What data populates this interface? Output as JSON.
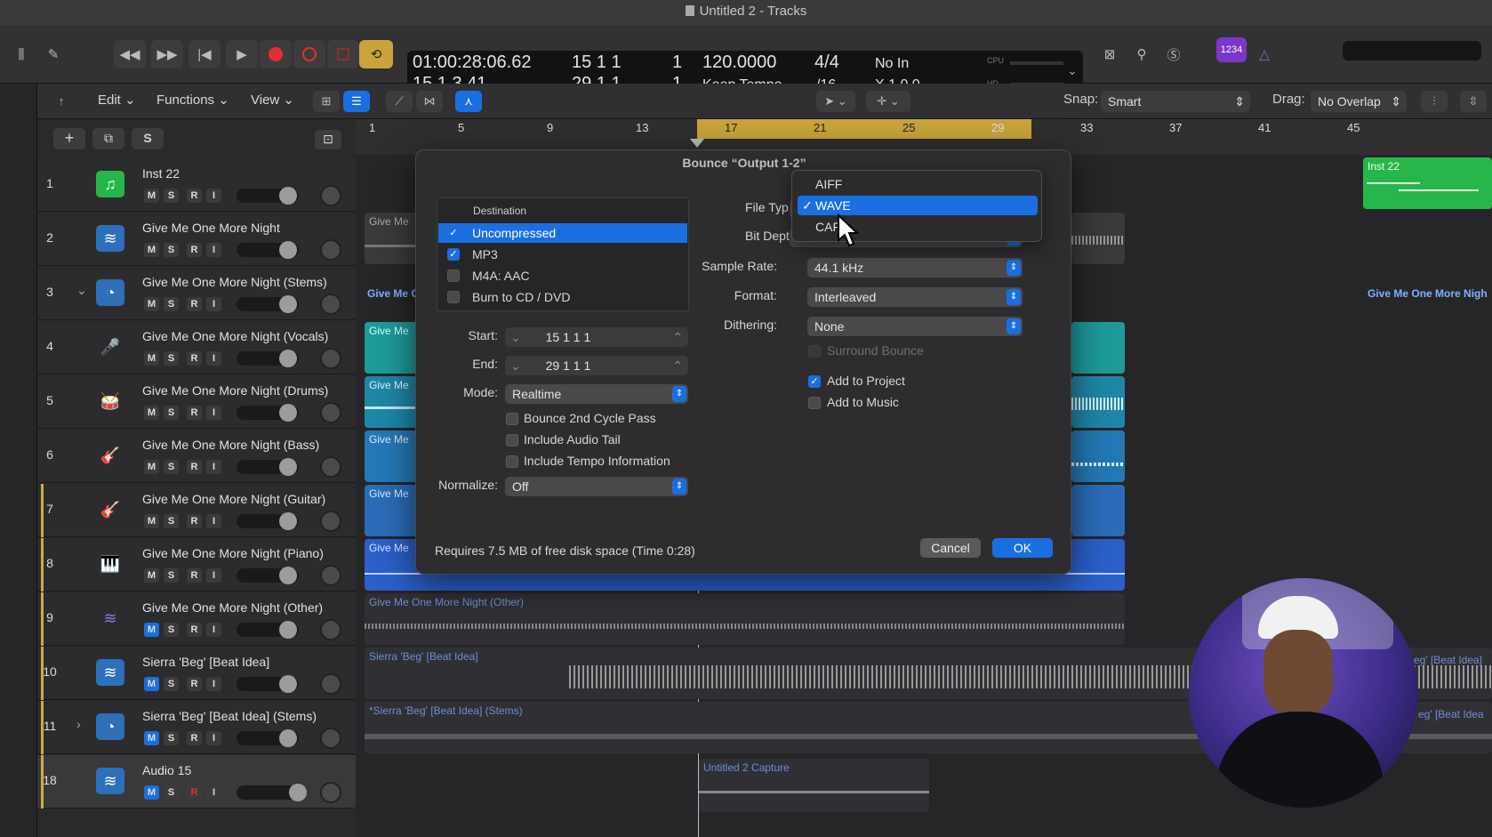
{
  "window": {
    "title": "Untitled 2 - Tracks"
  },
  "lcd": {
    "timecode_top": "01:00:28:06.62",
    "timecode_bottom": "15  1  3  41",
    "pos_top": "15  1  1",
    "pos_top_tick": "1",
    "pos_bottom": "29  1  1",
    "pos_bottom_tick": "1",
    "tempo": "120.0000",
    "tempo_mode": "Keep Tempo",
    "sig_top": "4/4",
    "sig_bottom": "/16",
    "input": "No In",
    "output": "X 1  0  0",
    "cpu_label": "CPU",
    "hd_label": "HD",
    "key_badge": "1234"
  },
  "localbar": {
    "edit": "Edit",
    "functions": "Functions",
    "view": "View",
    "snap_label": "Snap:",
    "snap_value": "Smart",
    "drag_label": "Drag:",
    "drag_value": "No Overlap"
  },
  "ruler": {
    "marks": [
      "1",
      "5",
      "9",
      "13",
      "17",
      "21",
      "25",
      "29",
      "33",
      "37",
      "41",
      "45"
    ]
  },
  "tracks": [
    {
      "num": "1",
      "name": "Inst 22"
    },
    {
      "num": "2",
      "name": "Give Me One More Night"
    },
    {
      "num": "3",
      "name": "Give Me One More Night (Stems)"
    },
    {
      "num": "4",
      "name": "Give Me One More Night (Vocals)"
    },
    {
      "num": "5",
      "name": "Give Me One More Night (Drums)"
    },
    {
      "num": "6",
      "name": "Give Me One More Night (Bass)"
    },
    {
      "num": "7",
      "name": "Give Me One More Night (Guitar)"
    },
    {
      "num": "8",
      "name": "Give Me One More Night (Piano)"
    },
    {
      "num": "9",
      "name": "Give Me One More Night (Other)"
    },
    {
      "num": "10",
      "name": "Sierra 'Beg' [Beat Idea]"
    },
    {
      "num": "11",
      "name": "Sierra 'Beg' [Beat Idea] (Stems)"
    },
    {
      "num": "18",
      "name": "Audio 15"
    }
  ],
  "msr": {
    "m": "M",
    "s": "S",
    "r": "R",
    "i": "I"
  },
  "regions": {
    "inst22": "Inst 22",
    "give_me_short": "Give Me",
    "give_me_c": "Give Me C",
    "give_me_right": "Give Me One More Nigh",
    "other": "Give Me One More Night (Other)",
    "sierra": "Sierra 'Beg' [Beat Idea]",
    "sierra_right": "eg' [Beat Idea]",
    "sierra_stems": "*Sierra 'Beg' [Beat Idea] (Stems)",
    "sierra_stems_right": "eg' [Beat Idea",
    "capture": "Untitled 2 Capture"
  },
  "dialog": {
    "title": "Bounce “Output 1-2”",
    "destination_header": "Destination",
    "destinations": [
      {
        "label": "Uncompressed",
        "checked": true
      },
      {
        "label": "MP3",
        "checked": true
      },
      {
        "label": "M4A: AAC",
        "checked": false
      },
      {
        "label": "Burn to CD / DVD",
        "checked": false
      }
    ],
    "start_label": "Start:",
    "start_value": "15  1  1       1",
    "end_label": "End:",
    "end_value": "29  1  1       1",
    "mode_label": "Mode:",
    "mode_value": "Realtime",
    "bounce_2nd": "Bounce 2nd Cycle Pass",
    "audio_tail": "Include Audio Tail",
    "tempo_info": "Include Tempo Information",
    "normalize_label": "Normalize:",
    "normalize_value": "Off",
    "file_type_label": "File Typ",
    "bit_depth_label": "Bit Dept",
    "sample_rate_label": "Sample Rate:",
    "sample_rate_value": "44.1 kHz",
    "format_label": "Format:",
    "format_value": "Interleaved",
    "dithering_label": "Dithering:",
    "dithering_value": "None",
    "surround": "Surround Bounce",
    "add_project": "Add to Project",
    "add_music": "Add to Music",
    "disk_info": "Requires 7.5 MB of free disk space  (Time 0:28)",
    "cancel": "Cancel",
    "ok": "OK"
  },
  "dropdown": {
    "items": [
      "AIFF",
      "WAVE",
      "CAF"
    ],
    "selected": "WAVE"
  },
  "colors": {
    "accent": "#1a6fe0",
    "cycle": "#c9a43a",
    "inst_green": "#27b64a",
    "audio_blue": "#2d6fb8",
    "teal": "#1d9a9a",
    "record": "#e0302f"
  }
}
